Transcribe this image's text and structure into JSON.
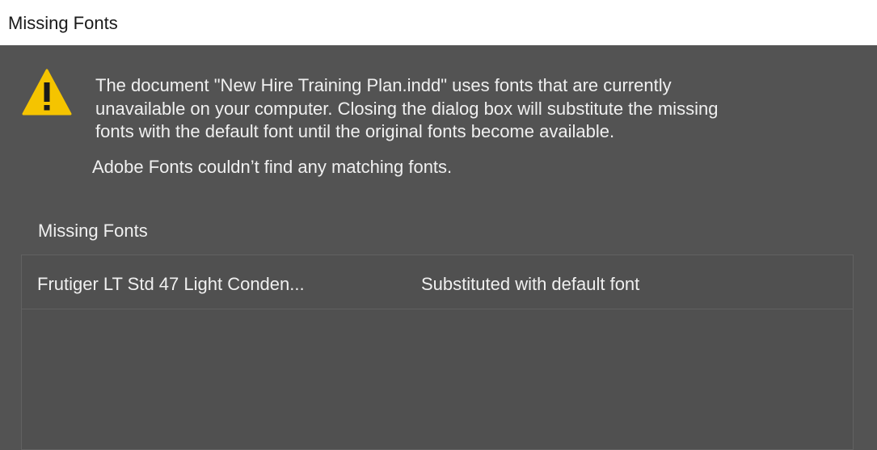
{
  "window": {
    "title": "Missing Fonts"
  },
  "message": {
    "line1": "The document \"New Hire Training Plan.indd\" uses fonts that are currently",
    "line2": "unavailable on your computer. Closing the dialog box will substitute the missing",
    "line3": "fonts with the default font until the original fonts become available."
  },
  "adobe_fonts_message": "Adobe Fonts couldn’t find any matching fonts.",
  "missing_fonts": {
    "label": "Missing Fonts",
    "items": [
      {
        "name": "Frutiger LT Std 47 Light Conden...",
        "status": "Substituted with default font"
      }
    ]
  },
  "colors": {
    "background": "#535353",
    "warning_yellow": "#f5c400",
    "text": "#f0f0f0"
  },
  "icons": {
    "warning": "warning-triangle-icon"
  }
}
